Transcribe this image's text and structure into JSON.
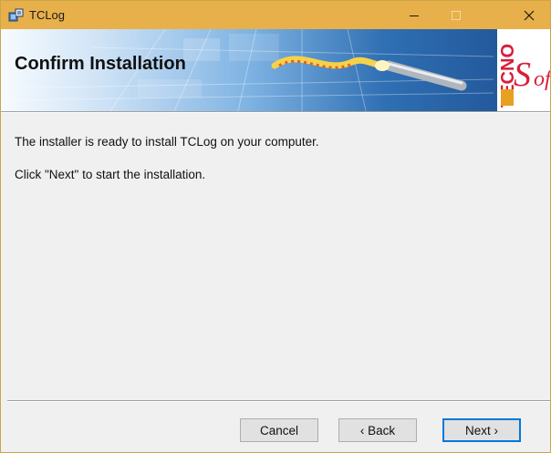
{
  "window": {
    "title": "TCLog",
    "app_icon": "installer-icon",
    "controls": {
      "minimize": "minimize-icon",
      "maximize": "maximize-icon",
      "close": "close-icon"
    }
  },
  "banner": {
    "title": "Confirm Installation",
    "logo_text": "TECNO Soft"
  },
  "content": {
    "line1": "The installer is ready to install TCLog on your computer.",
    "line2": "Click \"Next\" to start the installation."
  },
  "buttons": {
    "cancel": "Cancel",
    "back": "‹ Back",
    "next": "Next ›"
  },
  "colors": {
    "titlebar": "#e8b04a",
    "banner_dark": "#1d4f91",
    "logo_red": "#d81e3a",
    "logo_gold": "#e8a020",
    "focus_border": "#0078d7"
  }
}
